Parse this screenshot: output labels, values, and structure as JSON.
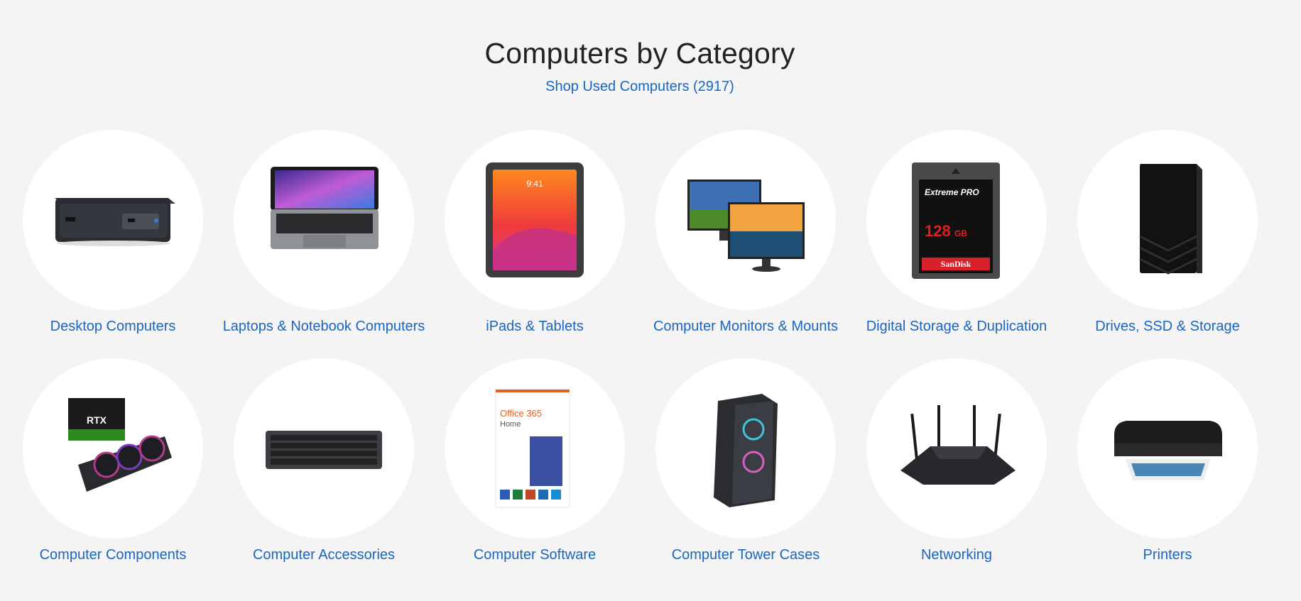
{
  "header": {
    "title": "Computers by Category",
    "shop_link": "Shop Used Computers (2917)"
  },
  "colors": {
    "link": "#1a66c0",
    "background": "#f4f4f4",
    "circle": "#ffffff"
  },
  "categories": [
    {
      "label": "Desktop Computers",
      "icon": "mini-pc-icon"
    },
    {
      "label": "Laptops & Notebook Computers",
      "icon": "laptop-icon"
    },
    {
      "label": "iPads & Tablets",
      "icon": "tablet-icon"
    },
    {
      "label": "Computer Monitors & Mounts",
      "icon": "monitors-icon"
    },
    {
      "label": "Digital Storage & Duplication",
      "icon": "memory-card-icon"
    },
    {
      "label": "Drives, SSD & Storage",
      "icon": "external-drive-icon"
    },
    {
      "label": "Computer Components",
      "icon": "graphics-card-icon"
    },
    {
      "label": "Computer Accessories",
      "icon": "keyboard-icon"
    },
    {
      "label": "Computer Software",
      "icon": "software-box-icon"
    },
    {
      "label": "Computer Tower Cases",
      "icon": "tower-case-icon"
    },
    {
      "label": "Networking",
      "icon": "router-icon"
    },
    {
      "label": "Printers",
      "icon": "printer-icon"
    }
  ],
  "image_text": {
    "tablet_time": "9:41",
    "card_brand_line": "Extreme PRO",
    "card_capacity": "128",
    "card_unit": "GB",
    "card_maker": "SanDisk",
    "gpu_box_text": "RTX",
    "software_title": "Office 365",
    "software_subtitle": "Home"
  }
}
